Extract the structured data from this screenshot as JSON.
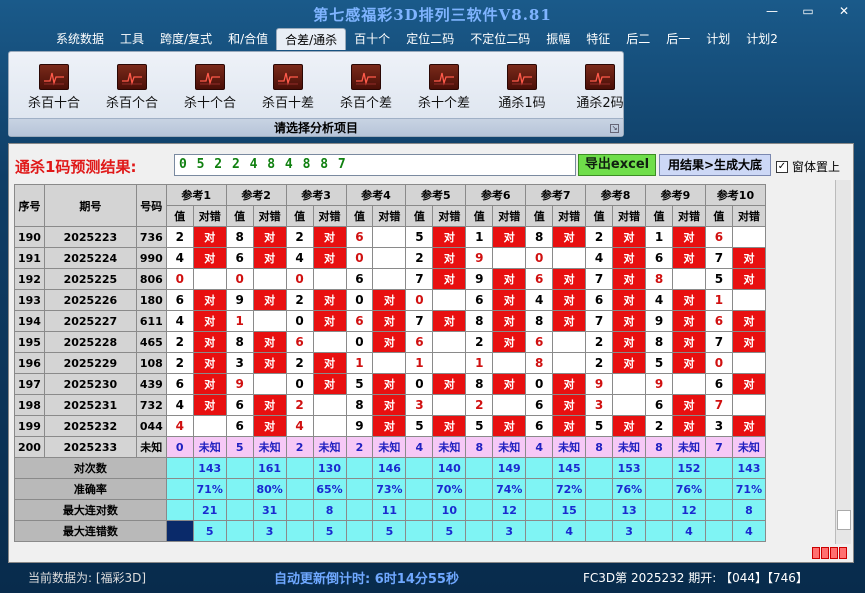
{
  "window": {
    "title": "第七感福彩3D排列三软件V8.81",
    "min": "—",
    "max": "▭",
    "close": "✕"
  },
  "menu": [
    {
      "label": "系统数据",
      "active": false
    },
    {
      "label": "工具",
      "active": false
    },
    {
      "label": "跨度/复式",
      "active": false
    },
    {
      "label": "和/合值",
      "active": false
    },
    {
      "label": "合差/通杀",
      "active": true
    },
    {
      "label": "百十个",
      "active": false
    },
    {
      "label": "定位二码",
      "active": false
    },
    {
      "label": "不定位二码",
      "active": false
    },
    {
      "label": "振幅",
      "active": false
    },
    {
      "label": "特征",
      "active": false
    },
    {
      "label": "后二",
      "active": false
    },
    {
      "label": "后一",
      "active": false
    },
    {
      "label": "计划",
      "active": false
    },
    {
      "label": "计划2",
      "active": false
    }
  ],
  "ribbon": {
    "items": [
      "杀百十合",
      "杀百个合",
      "杀十个合",
      "杀百十差",
      "杀百个差",
      "杀十个差",
      "通杀1码",
      "通杀2码"
    ],
    "footer": "请选择分析项目"
  },
  "prediction": {
    "label": "通杀1码预测结果:",
    "value": "0 5 2 2 4 8 4 8 8 7",
    "excel_button": "导出excel",
    "big_button": "用结果>生成大底",
    "pin_label": "窗体置上",
    "pin_checked": "✓"
  },
  "table": {
    "headers": {
      "index": "序号",
      "period": "期号",
      "number": "号码",
      "refs": [
        "参考1",
        "参考2",
        "参考3",
        "参考4",
        "参考5",
        "参考6",
        "参考7",
        "参考8",
        "参考9",
        "参考10"
      ],
      "value": "值",
      "result": "对错"
    },
    "hit_text": "对",
    "rows": [
      {
        "idx": "190",
        "period": "2025223",
        "number": "736",
        "vals": [
          "2",
          "8",
          "2",
          "6",
          "5",
          "1",
          "8",
          "2",
          "1",
          "6"
        ],
        "hits": [
          1,
          1,
          1,
          0,
          1,
          1,
          1,
          1,
          1,
          0
        ],
        "red": [
          0,
          0,
          0,
          1,
          0,
          0,
          0,
          0,
          0,
          1
        ]
      },
      {
        "idx": "191",
        "period": "2025224",
        "number": "990",
        "vals": [
          "4",
          "6",
          "4",
          "0",
          "2",
          "9",
          "0",
          "4",
          "6",
          "7"
        ],
        "hits": [
          1,
          1,
          1,
          0,
          1,
          0,
          0,
          1,
          1,
          1
        ],
        "red": [
          0,
          0,
          0,
          1,
          0,
          1,
          1,
          0,
          0,
          0
        ]
      },
      {
        "idx": "192",
        "period": "2025225",
        "number": "806",
        "vals": [
          "0",
          "0",
          "0",
          "6",
          "7",
          "9",
          "6",
          "7",
          "8",
          "5"
        ],
        "hits": [
          0,
          0,
          0,
          0,
          1,
          1,
          1,
          1,
          0,
          1
        ],
        "red": [
          1,
          1,
          1,
          0,
          0,
          0,
          1,
          0,
          1,
          0
        ]
      },
      {
        "idx": "193",
        "period": "2025226",
        "number": "180",
        "vals": [
          "6",
          "9",
          "2",
          "0",
          "0",
          "6",
          "4",
          "6",
          "4",
          "1"
        ],
        "hits": [
          1,
          1,
          1,
          1,
          0,
          1,
          1,
          1,
          1,
          0
        ],
        "red": [
          0,
          0,
          0,
          0,
          1,
          0,
          0,
          0,
          0,
          1
        ]
      },
      {
        "idx": "194",
        "period": "2025227",
        "number": "611",
        "vals": [
          "4",
          "1",
          "0",
          "6",
          "7",
          "8",
          "8",
          "7",
          "9",
          "6"
        ],
        "hits": [
          1,
          0,
          1,
          1,
          1,
          1,
          1,
          1,
          1,
          1
        ],
        "red": [
          0,
          1,
          0,
          1,
          0,
          0,
          0,
          0,
          0,
          1
        ]
      },
      {
        "idx": "195",
        "period": "2025228",
        "number": "465",
        "vals": [
          "2",
          "8",
          "6",
          "0",
          "6",
          "2",
          "6",
          "2",
          "8",
          "7"
        ],
        "hits": [
          1,
          1,
          0,
          1,
          0,
          1,
          0,
          1,
          1,
          1
        ],
        "red": [
          0,
          0,
          1,
          0,
          1,
          0,
          1,
          0,
          0,
          0
        ]
      },
      {
        "idx": "196",
        "period": "2025229",
        "number": "108",
        "vals": [
          "2",
          "3",
          "2",
          "1",
          "1",
          "1",
          "8",
          "2",
          "5",
          "0"
        ],
        "hits": [
          1,
          1,
          1,
          0,
          0,
          0,
          0,
          1,
          1,
          0
        ],
        "red": [
          0,
          0,
          0,
          1,
          1,
          1,
          1,
          0,
          0,
          1
        ]
      },
      {
        "idx": "197",
        "period": "2025230",
        "number": "439",
        "vals": [
          "6",
          "9",
          "0",
          "5",
          "0",
          "8",
          "0",
          "9",
          "9",
          "6"
        ],
        "hits": [
          1,
          0,
          1,
          1,
          1,
          1,
          1,
          0,
          0,
          1
        ],
        "red": [
          0,
          1,
          0,
          0,
          0,
          0,
          0,
          1,
          1,
          0
        ]
      },
      {
        "idx": "198",
        "period": "2025231",
        "number": "732",
        "vals": [
          "4",
          "6",
          "2",
          "8",
          "3",
          "2",
          "6",
          "3",
          "6",
          "7"
        ],
        "hits": [
          1,
          1,
          0,
          1,
          0,
          0,
          1,
          0,
          1,
          0
        ],
        "red": [
          0,
          0,
          1,
          0,
          1,
          1,
          0,
          1,
          0,
          1
        ]
      },
      {
        "idx": "199",
        "period": "2025232",
        "number": "044",
        "vals": [
          "4",
          "6",
          "4",
          "9",
          "5",
          "5",
          "6",
          "5",
          "2",
          "3"
        ],
        "hits": [
          0,
          1,
          0,
          1,
          1,
          1,
          1,
          1,
          1,
          1
        ],
        "red": [
          1,
          0,
          1,
          0,
          0,
          0,
          0,
          0,
          0,
          0
        ]
      }
    ],
    "unknown_row": {
      "idx": "200",
      "period": "2025233",
      "number": "未知",
      "vals": [
        "0",
        "5",
        "2",
        "2",
        "4",
        "8",
        "4",
        "8",
        "8",
        "7"
      ],
      "result": "未知"
    },
    "stats": [
      {
        "label": "对次数",
        "values": [
          "143",
          "161",
          "130",
          "146",
          "140",
          "149",
          "145",
          "153",
          "152",
          "143"
        ]
      },
      {
        "label": "准确率",
        "values": [
          "71%",
          "80%",
          "65%",
          "73%",
          "70%",
          "74%",
          "72%",
          "76%",
          "76%",
          "71%"
        ]
      },
      {
        "label": "最大连对数",
        "values": [
          "21",
          "31",
          "8",
          "11",
          "10",
          "12",
          "15",
          "13",
          "12",
          "8"
        ]
      },
      {
        "label": "最大连错数",
        "values": [
          "5",
          "3",
          "5",
          "5",
          "5",
          "3",
          "4",
          "3",
          "4",
          "4"
        ]
      }
    ]
  },
  "status": {
    "current": "当前数据为: [福彩3D]",
    "countdown": "自动更新倒计时: 6时14分55秒",
    "draw": "FC3D第 2025232 期开: 【044】【746】"
  },
  "colors": {
    "hit_red": "#e81010",
    "stat_cyan": "#7ff4f4",
    "unknown_pink": "#f6c8f6",
    "excel_green": "#6fde4a"
  }
}
